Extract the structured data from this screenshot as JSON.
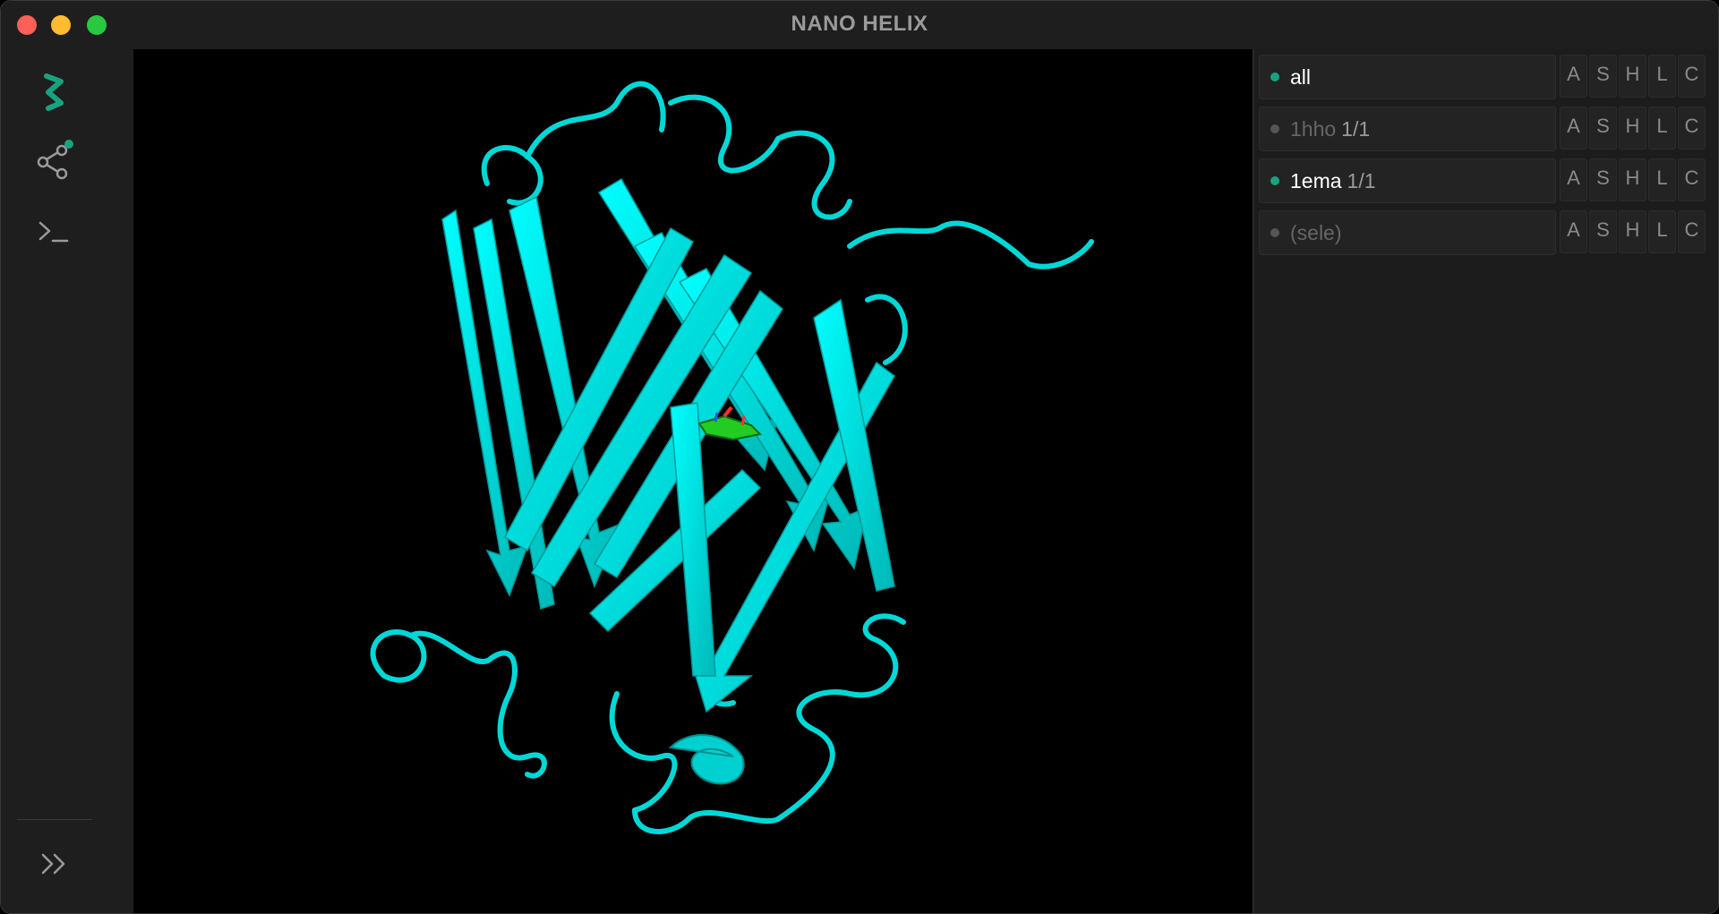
{
  "window": {
    "title": "NANO HELIX"
  },
  "sidebar": {
    "items": [
      {
        "icon": "helix-logo-icon"
      },
      {
        "icon": "share-icon",
        "badge": "notification-dot"
      },
      {
        "icon": "terminal-icon"
      },
      {
        "icon": "expand-chevrons-icon"
      }
    ]
  },
  "viewport": {
    "description_colors": {
      "ribbon": "#00e5e5",
      "ligand": "#22cc22",
      "background": "#000000"
    }
  },
  "objects_panel": {
    "rows": [
      {
        "name": "all",
        "count": "",
        "active": true,
        "name_color": "#ffffff",
        "count_color": "#9a9a9a"
      },
      {
        "name": "1hho",
        "count": "1/1",
        "active": false,
        "name_color": "#666666",
        "count_color": "#9a9a9a"
      },
      {
        "name": "1ema",
        "count": "1/1",
        "active": true,
        "name_color": "#ffffff",
        "count_color": "#9a9a9a"
      },
      {
        "name": "(sele)",
        "count": "",
        "active": false,
        "name_color": "#666666",
        "count_color": "#9a9a9a"
      }
    ],
    "action_buttons": [
      "A",
      "S",
      "H",
      "L",
      "C"
    ]
  },
  "colors": {
    "accent": "#18a37e",
    "inactive_dot": "#555555"
  }
}
